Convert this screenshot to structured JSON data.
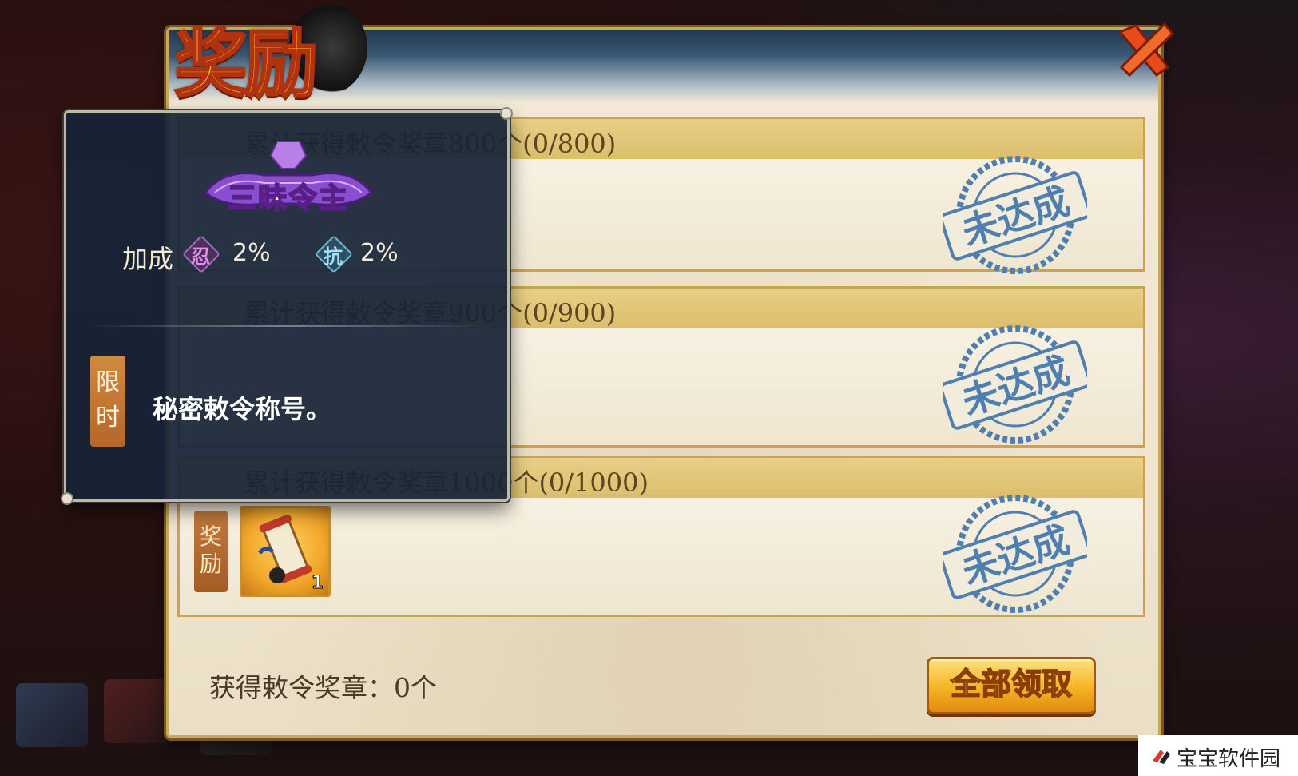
{
  "title": "奖励",
  "quests": [
    {
      "title": "累计获得敕令奖章800个(0/800)",
      "status": "未达成"
    },
    {
      "title": "累计获得敕令奖章900个(0/900)",
      "status": "未达成"
    },
    {
      "title": "累计获得敕令奖章1000个(0/1000)",
      "status": "未达成",
      "reward_label": "奖励",
      "reward_item": {
        "icon": "title-scroll-icon",
        "count": "1"
      }
    }
  ],
  "footer": {
    "medal_count": "获得敕令奖章：0个",
    "claim_all": "全部领取"
  },
  "tooltip": {
    "title_name": "三昧令主",
    "bonus_label": "加成",
    "attributes": [
      {
        "icon": "忍",
        "value": "2%"
      },
      {
        "icon": "抗",
        "value": "2%"
      }
    ],
    "limit_tag": "限时",
    "description": "秘密敕令称号。"
  },
  "watermark": "宝宝软件园",
  "colors": {
    "accent_gold": "#f5b423",
    "stamp_blue": "#4f7fb0",
    "title_purple": "#8a4fd0"
  }
}
